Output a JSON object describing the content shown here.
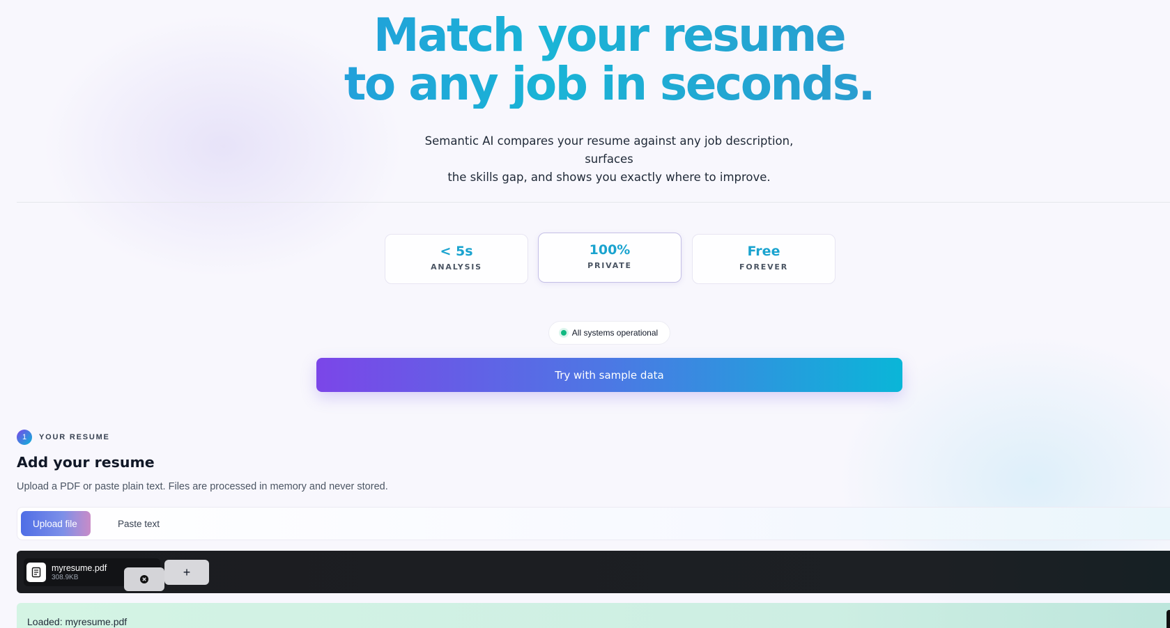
{
  "hero": {
    "title_line1": "Match your resume",
    "title_line2": "to any job in seconds.",
    "subtitle_line1": "Semantic AI compares your resume against any job description, surfaces",
    "subtitle_line2": "the skills gap, and shows you exactly where to improve."
  },
  "stats": [
    {
      "value": "< 5s",
      "label": "ANALYSIS"
    },
    {
      "value": "100%",
      "label": "PRIVATE"
    },
    {
      "value": "Free",
      "label": "FOREVER"
    }
  ],
  "status": {
    "text": "All systems operational",
    "color": "#10b981"
  },
  "sample_button": {
    "label": "Try with sample data"
  },
  "step": {
    "number": "1",
    "label": "YOUR RESUME"
  },
  "section": {
    "title": "Add your resume",
    "description": "Upload a PDF or paste plain text. Files are processed in memory and never stored."
  },
  "tabs": {
    "upload_label": "Upload file",
    "paste_label": "Paste text",
    "active": "Upload file"
  },
  "file": {
    "name": "myresume.pdf",
    "size": "308.9KB",
    "add_label": "+"
  },
  "loaded": {
    "text": "Loaded: myresume.pdf"
  },
  "icons": {
    "file": "document-icon",
    "remove": "close-circle-icon",
    "add": "plus-icon",
    "status": "status-dot-icon"
  },
  "colors": {
    "accent_start": "#7b46e8",
    "accent_end": "#0ab6d8",
    "stat_value": "#1aa3cf",
    "status_ok": "#10b981"
  }
}
